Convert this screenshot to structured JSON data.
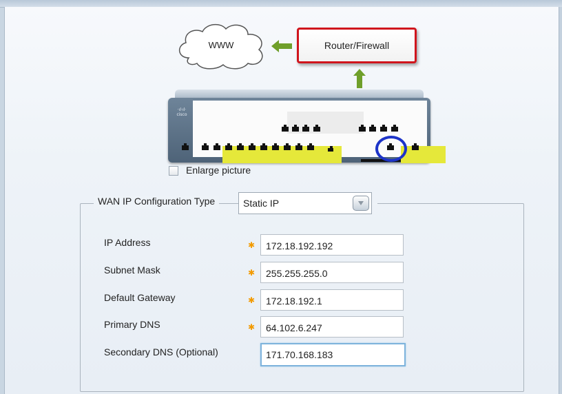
{
  "diagram": {
    "cloud_label": "WWW",
    "router_label": "Router/Firewall"
  },
  "enlarge": {
    "label": "Enlarge picture",
    "checked": false
  },
  "wan": {
    "legend": "WAN IP Configuration Type",
    "type_value": "Static IP"
  },
  "fields": [
    {
      "label": "IP Address",
      "value": "172.18.192.192",
      "required": true
    },
    {
      "label": "Subnet Mask",
      "value": "255.255.255.0",
      "required": true
    },
    {
      "label": "Default Gateway",
      "value": "172.18.192.1",
      "required": true
    },
    {
      "label": "Primary DNS",
      "value": "64.102.6.247",
      "required": true
    },
    {
      "label": "Secondary DNS (Optional)",
      "value": "171.70.168.183",
      "required": false
    }
  ],
  "colors": {
    "router_border": "#d0141c",
    "arrow": "#6f9f2a",
    "port_highlight": "#1d34c8",
    "required_marker": "#f29a00",
    "focus_border": "#7db3dc"
  },
  "icons": {
    "required": "required-star-icon",
    "dropdown": "chevron-down-icon",
    "cloud": "cloud-icon",
    "arrow": "arrow-icon"
  }
}
